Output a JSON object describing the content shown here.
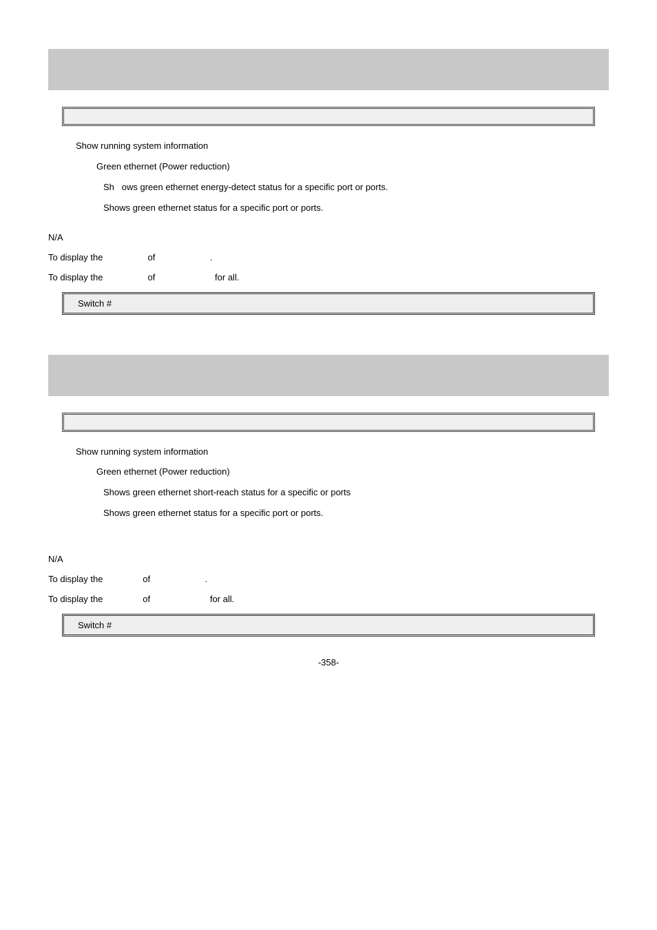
{
  "sec1": {
    "params": {
      "show_desc": "Show running system information",
      "green_desc": "Green ethernet (Power reduction)",
      "energy_pre": "Sh",
      "energy_desc": "ows green ethernet energy-detect status for a specific port or ports.",
      "interface_desc": "Shows green ethernet status for a specific port or ports."
    },
    "default": "N/A",
    "usage1_a": "To display the",
    "usage1_b": "of",
    "usage1_c": ".",
    "usage2_a": "To display the",
    "usage2_b": "of",
    "usage2_c": "for all.",
    "example": "Switch #"
  },
  "sec2": {
    "params": {
      "show_desc": "Show running system information",
      "green_desc": "Green ethernet (Power reduction)",
      "short_desc": "Shows green ethernet short-reach status for a specific or ports",
      "interface_desc": "Shows green ethernet status for a specific port or ports."
    },
    "default": "N/A",
    "usage1_a": "To display the",
    "usage1_b": "of",
    "usage1_c": ".",
    "usage2_a": "To display the",
    "usage2_b": "of",
    "usage2_c": "for all.",
    "example": "Switch #"
  },
  "footer": "-358-"
}
